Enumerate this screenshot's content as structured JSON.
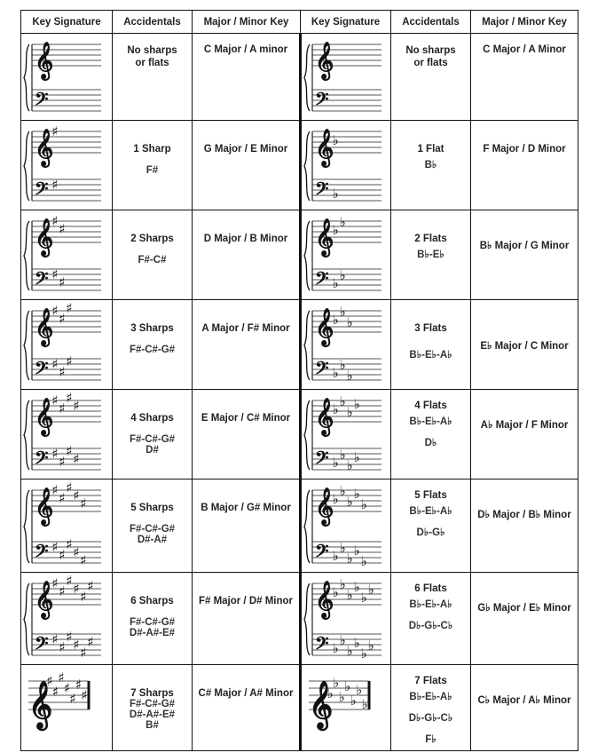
{
  "headers": [
    "Key Signature",
    "Accidentals",
    "Major / Minor Key",
    "Key Signature",
    "Accidentals",
    "Major / Minor Key"
  ],
  "rows": [
    {
      "left": {
        "type": "sharp",
        "count": 0,
        "staff": "grand",
        "accidental_title": "No sharps or flats",
        "accidental_lines": [],
        "key": "C Major / A minor",
        "title_pad": 12,
        "key_pad": 12
      },
      "right": {
        "type": "flat",
        "count": 0,
        "staff": "grand",
        "accidental_title": "No sharps or flats",
        "accidental_lines": [],
        "key": "C Major / A Minor",
        "title_pad": 12,
        "key_pad": 12
      }
    },
    {
      "left": {
        "type": "sharp",
        "count": 1,
        "staff": "grand",
        "accidental_title": "1 Sharp",
        "accidental_lines": [
          "F#"
        ],
        "key": "G Major / E Minor",
        "title_pad": 26,
        "key_pad": 26
      },
      "right": {
        "type": "flat",
        "count": 1,
        "staff": "grand",
        "accidental_title": "1 Flat",
        "accidental_lines": [
          "B♭"
        ],
        "key": "F Major / D Minor",
        "title_pad": 26,
        "key_pad": 26
      }
    },
    {
      "left": {
        "type": "sharp",
        "count": 2,
        "staff": "grand",
        "accidental_title": "2 Sharps",
        "accidental_lines": [
          "F#-C#"
        ],
        "key": "D Major / B Minor",
        "title_pad": 26,
        "key_pad": 26
      },
      "right": {
        "type": "flat",
        "count": 2,
        "staff": "grand",
        "accidental_title": "2 Flats",
        "accidental_lines": [
          "B♭-E♭"
        ],
        "key": "B♭ Major / G Minor",
        "title_pad": 26,
        "key_pad": 32
      }
    },
    {
      "left": {
        "type": "sharp",
        "count": 3,
        "staff": "grand",
        "accidental_title": "3 Sharps",
        "accidental_lines": [
          "F#-C#-G#"
        ],
        "key": "A Major / F# Minor",
        "title_pad": 26,
        "key_pad": 26
      },
      "right": {
        "type": "flat",
        "count": 3,
        "staff": "grand",
        "accidental_title": "3 Flats",
        "accidental_lines": [
          "B♭-E♭-A♭"
        ],
        "key": "E♭ Major / C Minor",
        "title_pad": 26,
        "key_pad": 44
      }
    },
    {
      "left": {
        "type": "sharp",
        "count": 4,
        "staff": "grand",
        "accidental_title": "4 Sharps",
        "accidental_lines": [
          "F#-C#-G#",
          "D#"
        ],
        "key": "E Major / C# Minor",
        "title_pad": 26,
        "key_pad": 26
      },
      "right": {
        "type": "flat",
        "count": 4,
        "staff": "grand",
        "accidental_title": "4 Flats",
        "accidental_lines": [
          "B♭-E♭-A♭",
          "D♭"
        ],
        "key": "A♭ Major / F Minor",
        "title_pad": 12,
        "key_pad": 32
      }
    },
    {
      "left": {
        "type": "sharp",
        "count": 5,
        "staff": "grand",
        "accidental_title": "5 Sharps",
        "accidental_lines": [
          "F#-C#-G#",
          "D#-A#"
        ],
        "key": "B Major / G# Minor",
        "title_pad": 26,
        "key_pad": 26
      },
      "right": {
        "type": "flat",
        "count": 5,
        "staff": "grand",
        "accidental_title": "5 Flats",
        "accidental_lines": [
          "B♭-E♭-A♭",
          "D♭-G♭"
        ],
        "key": "D♭ Major / B♭ Minor",
        "title_pad": 12,
        "key_pad": 32
      }
    },
    {
      "left": {
        "type": "sharp",
        "count": 6,
        "staff": "grand",
        "accidental_title": "6 Sharps",
        "accidental_lines": [
          "F#-C#-G#",
          "D#-A#-E#"
        ],
        "key": "F# Major / D# Minor",
        "title_pad": 26,
        "key_pad": 26
      },
      "right": {
        "type": "flat",
        "count": 6,
        "staff": "grand",
        "accidental_title": "6 Flats",
        "accidental_lines": [
          "B♭-E♭-A♭",
          "D♭-G♭-C♭"
        ],
        "key": "G♭ Major / E♭ Minor",
        "title_pad": 12,
        "key_pad": 32
      }
    },
    {
      "left": {
        "type": "sharp",
        "count": 7,
        "staff": "treble",
        "accidental_title": "7 Sharps",
        "accidental_lines": [
          "F#-C#-G#",
          "D#-A#-E#",
          "B#"
        ],
        "key": "C# Major / A# Minor",
        "title_pad": 26,
        "key_pad": 26
      },
      "right": {
        "type": "flat",
        "count": 7,
        "staff": "treble",
        "accidental_title": "7 Flats",
        "accidental_lines": [
          "B♭-E♭-A♭",
          "D♭-G♭-C♭",
          "F♭"
        ],
        "key": "C♭ Major / A♭ Minor",
        "title_pad": 12,
        "key_pad": 32
      }
    }
  ]
}
